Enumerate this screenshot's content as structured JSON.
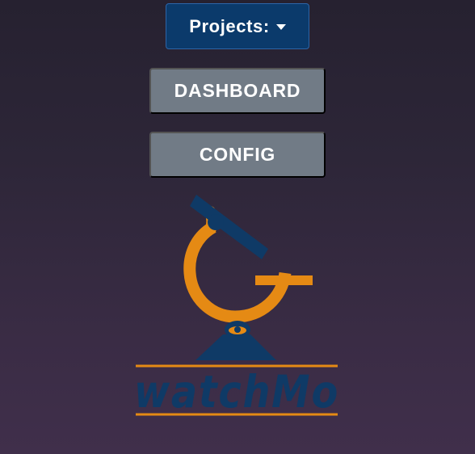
{
  "toolbar": {
    "projects_label": "Projects:"
  },
  "nav": {
    "dashboard_label": "DASHBOARD",
    "config_label": "CONFIG"
  },
  "logo": {
    "brand_text": "watchMo",
    "colors": {
      "orange": "#e58a14",
      "navy": "#0f3a66"
    }
  },
  "colors": {
    "projects_button_bg": "#0b3a6b",
    "nav_button_bg": "#717b86",
    "text": "#ffffff"
  }
}
